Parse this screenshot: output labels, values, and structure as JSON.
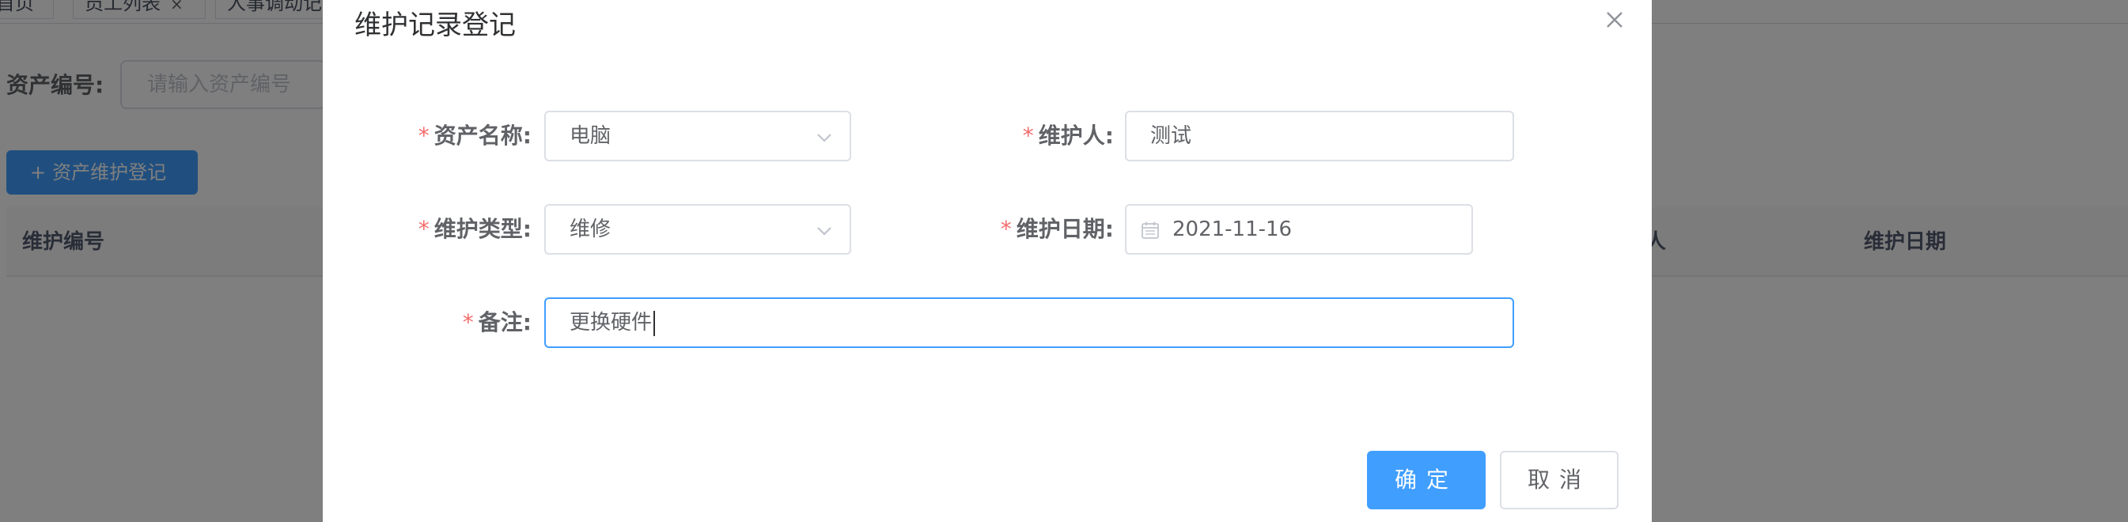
{
  "tabs": [
    {
      "label": "首页"
    },
    {
      "label": "员工列表",
      "close": "×"
    },
    {
      "label": "人事调动记录"
    }
  ],
  "search": {
    "asset_no_label": "资产编号:",
    "asset_no_placeholder": "请输入资产编号"
  },
  "toolbar": {
    "add_icon": "+",
    "add_label": "资产维护登记"
  },
  "table": {
    "headers": [
      "维护编号",
      "人",
      "维护日期"
    ]
  },
  "dialog": {
    "title": "维护记录登记",
    "required_mark": "*",
    "fields": {
      "asset_name": {
        "label": "资产名称:",
        "value": "电脑"
      },
      "maintainer": {
        "label": "维护人:",
        "value": "测试"
      },
      "maintenance_type": {
        "label": "维护类型:",
        "value": "维修"
      },
      "maintenance_date": {
        "label": "维护日期:",
        "value": "2021-11-16"
      },
      "remark": {
        "label": "备注:",
        "value": "更换硬件"
      }
    },
    "confirm_label": "确定",
    "cancel_label": "取消"
  },
  "colors": {
    "primary": "#409eff",
    "required": "#f56c6c",
    "mask": "rgba(0,0,0,0.5)"
  },
  "icons": [
    "close-icon",
    "chevron-down-icon",
    "calendar-icon",
    "plus-icon"
  ]
}
